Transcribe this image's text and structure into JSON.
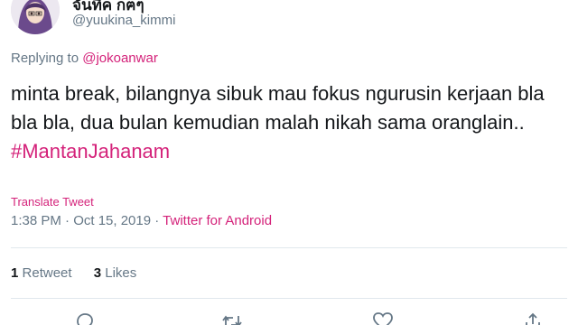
{
  "user": {
    "display_name": "จันทีค กฅๆ",
    "handle": "@yuukina_kimmi",
    "avatar_icon": "avatar-hijab-girl"
  },
  "reply": {
    "prefix": "Replying to",
    "mention": "@jokoanwar"
  },
  "tweet": {
    "text": "minta break, bilangnya sibuk mau fokus ngurusin kerjaan bla bla bla, dua bulan kemudian malah nikah sama oranglain.. ",
    "hashtag": "#MantanJahanam"
  },
  "translate_label": "Translate Tweet",
  "meta": {
    "timestamp": "1:38 PM · Oct 15, 2019 · ",
    "source": "Twitter for Android"
  },
  "stats": {
    "retweets_count": "1",
    "retweets_label": "Retweet",
    "likes_count": "3",
    "likes_label": "Likes"
  },
  "actions": [
    "reply-icon",
    "retweet-icon",
    "like-icon",
    "share-icon"
  ],
  "colors": {
    "accent": "#d4227a",
    "secondary_text": "#657786",
    "divider": "#e1e8ed"
  }
}
